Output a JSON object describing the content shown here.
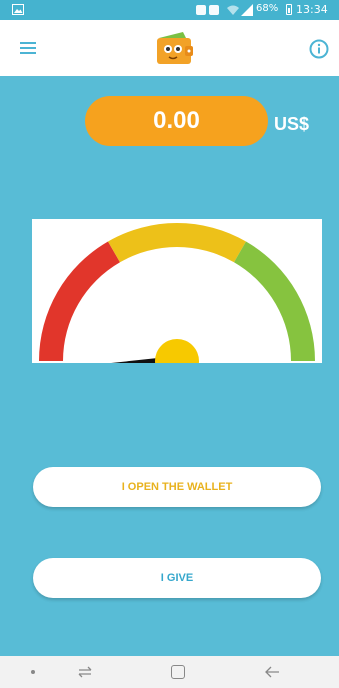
{
  "status_bar": {
    "battery_percent": "68%",
    "time": "13:34"
  },
  "app_bar": {
    "menu_icon": "hamburger-menu-icon",
    "logo_icon": "wallet-logo-icon",
    "info_icon": "info-icon"
  },
  "balance": {
    "amount": "0.00",
    "currency": "US$"
  },
  "gauge": {
    "segments": [
      {
        "color": "#E1362B"
      },
      {
        "color": "#EDC119"
      },
      {
        "color": "#86C33F"
      }
    ],
    "needle_level": 0.0,
    "hub_color": "#F7C900"
  },
  "actions": {
    "open_wallet_label": "I OPEN THE WALLET",
    "give_label": "I GIVE"
  },
  "colors": {
    "background": "#58BCD6",
    "status_bar": "#45B3CF",
    "accent_orange": "#F6A21E",
    "open_wallet_text": "#E8B21E",
    "give_text": "#35A7CC"
  }
}
